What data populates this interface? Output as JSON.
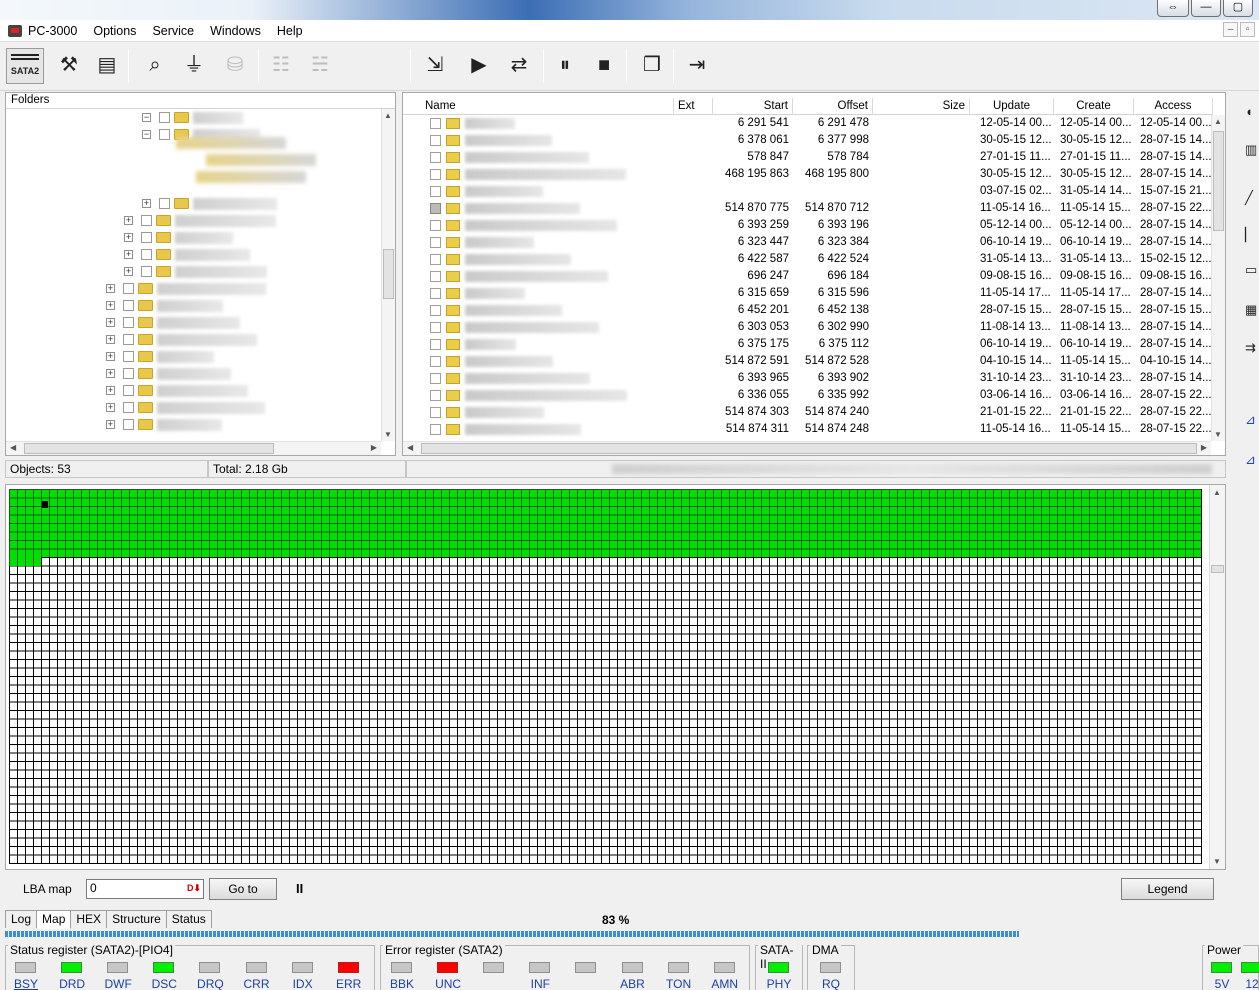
{
  "app": {
    "title": "PC-3000"
  },
  "menu": [
    "PC-3000",
    "Options",
    "Service",
    "Windows",
    "Help"
  ],
  "toolbar": {
    "interface_label": "SATA2"
  },
  "folders": {
    "header": "Folders"
  },
  "files": {
    "columns": [
      "Name",
      "Ext",
      "Start",
      "Offset",
      "Size",
      "Update",
      "Create",
      "Access"
    ],
    "rows": [
      {
        "start": "6 291 541",
        "offset": "6 291 478",
        "update": "12-05-14 00...",
        "create": "12-05-14 00...",
        "access": "12-05-14 00..."
      },
      {
        "start": "6 378 061",
        "offset": "6 377 998",
        "update": "30-05-15 12...",
        "create": "30-05-15 12...",
        "access": "28-07-15 14..."
      },
      {
        "start": "578 847",
        "offset": "578 784",
        "update": "27-01-15 11...",
        "create": "27-01-15 11...",
        "access": "28-07-15 14..."
      },
      {
        "start": "468 195 863",
        "offset": "468 195 800",
        "update": "30-05-15 12...",
        "create": "30-05-15 12...",
        "access": "28-07-15 14..."
      },
      {
        "start": "",
        "offset": "",
        "update": "03-07-15 02...",
        "create": "31-05-14 14...",
        "access": "15-07-15 21..."
      },
      {
        "start": "514 870 775",
        "offset": "514 870 712",
        "update": "11-05-14 16...",
        "create": "11-05-14 15...",
        "access": "28-07-15 22..."
      },
      {
        "start": "6 393 259",
        "offset": "6 393 196",
        "update": "05-12-14 00...",
        "create": "05-12-14 00...",
        "access": "28-07-15 14..."
      },
      {
        "start": "6 323 447",
        "offset": "6 323 384",
        "update": "06-10-14 19...",
        "create": "06-10-14 19...",
        "access": "28-07-15 14..."
      },
      {
        "start": "6 422 587",
        "offset": "6 422 524",
        "update": "31-05-14 13...",
        "create": "31-05-14 13...",
        "access": "15-02-15 12..."
      },
      {
        "start": "696 247",
        "offset": "696 184",
        "update": "09-08-15 16...",
        "create": "09-08-15 16...",
        "access": "09-08-15 16..."
      },
      {
        "start": "6 315 659",
        "offset": "6 315 596",
        "update": "11-05-14 17...",
        "create": "11-05-14 17...",
        "access": "28-07-15 14..."
      },
      {
        "start": "6 452 201",
        "offset": "6 452 138",
        "update": "28-07-15 15...",
        "create": "28-07-15 15...",
        "access": "28-07-15 15..."
      },
      {
        "start": "6 303 053",
        "offset": "6 302 990",
        "update": "11-08-14 13...",
        "create": "11-08-14 13...",
        "access": "28-07-15 14..."
      },
      {
        "start": "6 375 175",
        "offset": "6 375 112",
        "update": "06-10-14 19...",
        "create": "06-10-14 19...",
        "access": "28-07-15 14..."
      },
      {
        "start": "514 872 591",
        "offset": "514 872 528",
        "update": "04-10-15 14...",
        "create": "11-05-14 15...",
        "access": "04-10-15 14..."
      },
      {
        "start": "6 393 965",
        "offset": "6 393 902",
        "update": "31-10-14 23...",
        "create": "31-10-14 23...",
        "access": "28-07-15 14..."
      },
      {
        "start": "6 336 055",
        "offset": "6 335 992",
        "update": "03-06-14 16...",
        "create": "03-06-14 16...",
        "access": "28-07-15 22..."
      },
      {
        "start": "514 874 303",
        "offset": "514 874 240",
        "update": "21-01-15 22...",
        "create": "21-01-15 22...",
        "access": "28-07-15 22..."
      },
      {
        "start": "514 874 311",
        "offset": "514 874 248",
        "update": "11-05-14 16...",
        "create": "11-05-14 15...",
        "access": "28-07-15 22..."
      }
    ]
  },
  "status": {
    "objects": "Objects: 53",
    "total": "Total: 2.18 Gb"
  },
  "map": {
    "filled_fraction": 0.17,
    "label": "LBA map",
    "lba_value": "0",
    "goto_label": "Go to",
    "pause_label": "II",
    "legend_label": "Legend"
  },
  "tabs": [
    "Log",
    "Map",
    "HEX",
    "Structure",
    "Status"
  ],
  "progress": {
    "percent_text": "83 %",
    "value": 0.83
  },
  "registers": {
    "status": {
      "title": "Status register (SATA2)-[PIO4]",
      "leds": [
        {
          "label": "BSY",
          "state": "off"
        },
        {
          "label": "DRD",
          "state": "green"
        },
        {
          "label": "DWF",
          "state": "off"
        },
        {
          "label": "DSC",
          "state": "green"
        },
        {
          "label": "DRQ",
          "state": "off"
        },
        {
          "label": "CRR",
          "state": "off"
        },
        {
          "label": "IDX",
          "state": "off"
        },
        {
          "label": "ERR",
          "state": "red"
        }
      ]
    },
    "error": {
      "title": "Error register (SATA2)",
      "leds": [
        {
          "label": "BBK",
          "state": "off"
        },
        {
          "label": "UNC",
          "state": "red"
        },
        {
          "label": "",
          "state": "off"
        },
        {
          "label": "INF",
          "state": "off"
        },
        {
          "label": "",
          "state": "off"
        },
        {
          "label": "ABR",
          "state": "off"
        },
        {
          "label": "TON",
          "state": "off"
        },
        {
          "label": "AMN",
          "state": "off"
        }
      ]
    },
    "sata": {
      "title": "SATA-II",
      "leds": [
        {
          "label": "PHY",
          "state": "green"
        }
      ]
    },
    "dma": {
      "title": "DMA",
      "leds": [
        {
          "label": "RQ",
          "state": "off"
        }
      ]
    },
    "power": {
      "title": "Power",
      "leds": [
        {
          "label": "5V",
          "state": "green"
        },
        {
          "label": "12",
          "state": "green"
        }
      ]
    }
  },
  "colors": {
    "ok_block": "#00e000",
    "led_green": "#00f000",
    "led_red": "#ff0000",
    "progress": "#3d8fd8"
  }
}
